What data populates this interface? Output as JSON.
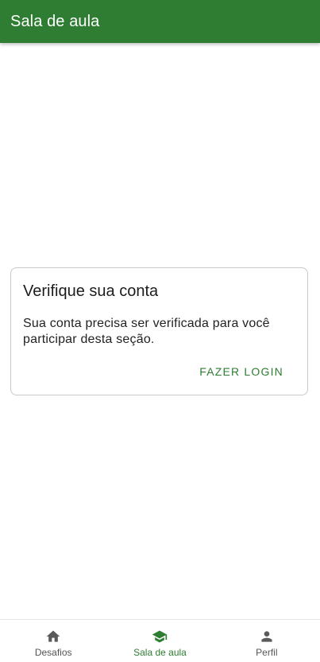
{
  "header": {
    "title": "Sala de aula"
  },
  "card": {
    "title": "Verifique sua conta",
    "body": "Sua conta precisa ser verificada para você participar desta seção.",
    "action": "FAZER LOGIN"
  },
  "bottom_nav": {
    "items": [
      {
        "label": "Desafios",
        "icon": "home-icon",
        "active": false
      },
      {
        "label": "Sala de aula",
        "icon": "graduation-cap-icon",
        "active": true
      },
      {
        "label": "Perfil",
        "icon": "person-icon",
        "active": false
      }
    ]
  },
  "colors": {
    "primary": "#2e7d32",
    "inactive": "#555555",
    "border": "#c9c9c9"
  }
}
